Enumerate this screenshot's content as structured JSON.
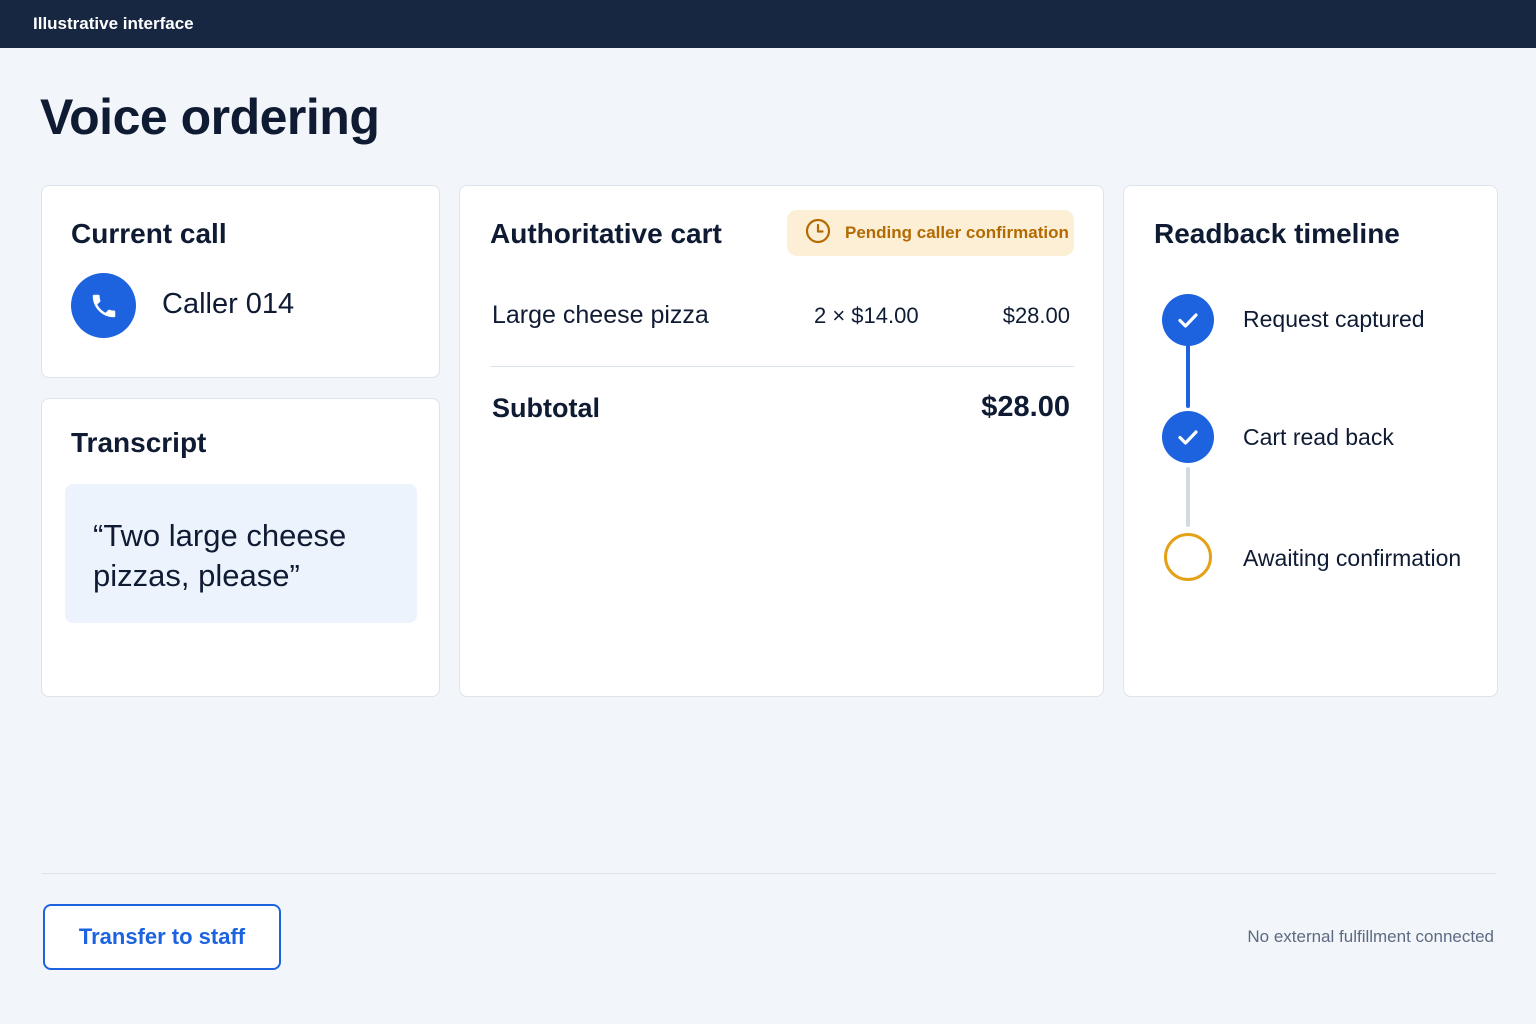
{
  "topbar": {
    "label": "Illustrative interface"
  },
  "page": {
    "title": "Voice ordering"
  },
  "current_call": {
    "title": "Current call",
    "icon": "phone-icon",
    "caller": "Caller 014"
  },
  "transcript": {
    "title": "Transcript",
    "text": "“Two large cheese pizzas, please”"
  },
  "cart": {
    "title": "Authoritative cart",
    "status_badge": {
      "icon": "clock-icon",
      "label": "Pending caller confirmation",
      "color": "#b46a00",
      "background": "#fcefd6"
    },
    "items": [
      {
        "name": "Large cheese pizza",
        "qty_price": "2 × $14.00",
        "total": "$28.00"
      }
    ],
    "subtotal_label": "Subtotal",
    "subtotal_value": "$28.00"
  },
  "timeline": {
    "title": "Readback timeline",
    "steps": [
      {
        "label": "Request captured",
        "status": "done",
        "icon": "check-icon"
      },
      {
        "label": "Cart read back",
        "status": "done",
        "icon": "check-icon"
      },
      {
        "label": "Awaiting confirmation",
        "status": "pending",
        "icon": "empty-circle-icon"
      }
    ]
  },
  "footer": {
    "transfer_label": "Transfer to staff",
    "note": "No external fulfillment connected"
  },
  "colors": {
    "accent": "#1d63e0",
    "pending": "#e5a118",
    "header": "#172741"
  }
}
